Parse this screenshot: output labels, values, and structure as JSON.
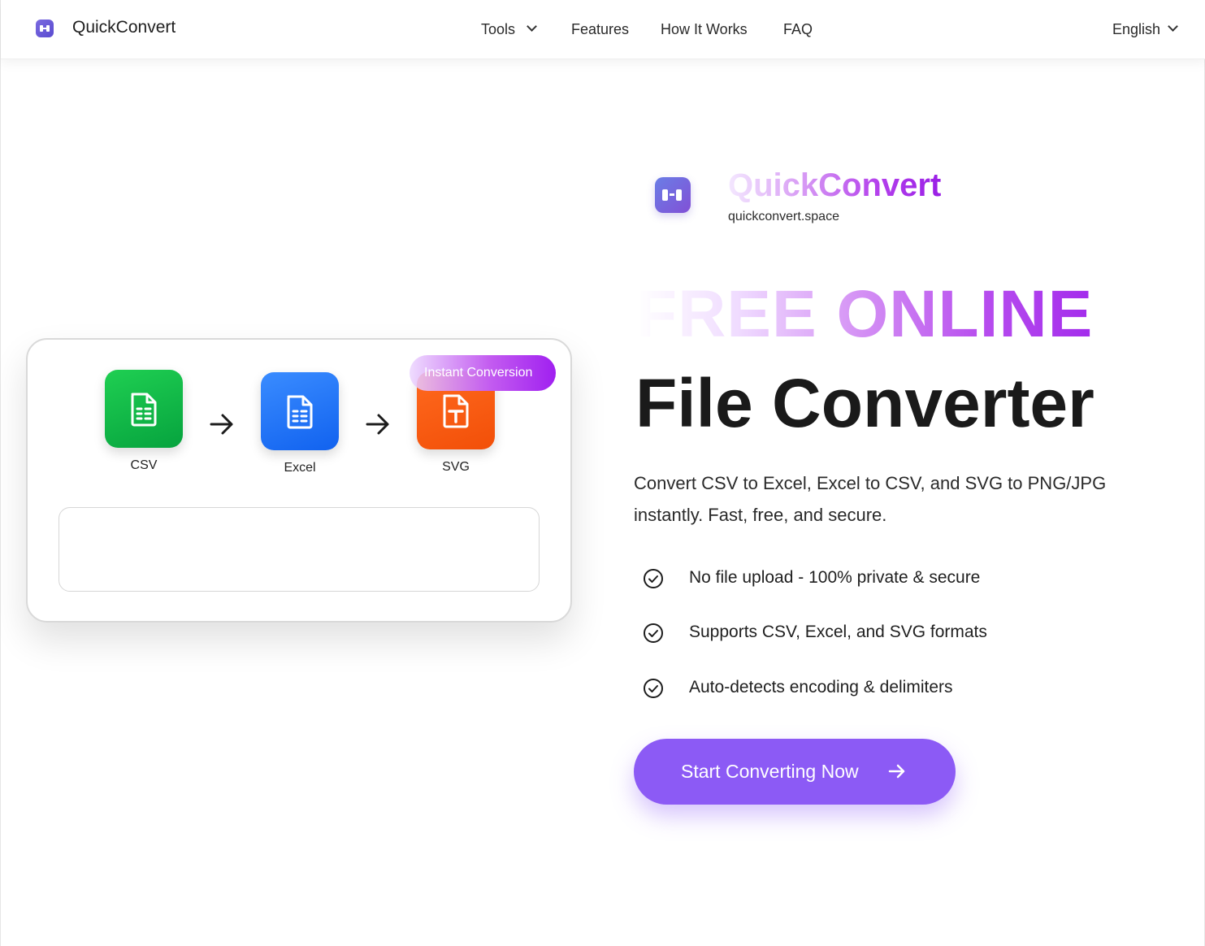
{
  "header": {
    "brand": "QuickConvert",
    "nav": {
      "tools": "Tools",
      "features": "Features",
      "how_it_works": "How It Works",
      "faq": "FAQ"
    },
    "language": "English"
  },
  "converter_card": {
    "badge": "Instant Conversion",
    "formats": {
      "csv": "CSV",
      "excel": "Excel",
      "svg": "SVG"
    }
  },
  "hero": {
    "brand": "QuickConvert",
    "domain": "quickconvert.space",
    "title_line1": "FREE ONLINE",
    "title_line2": "File Converter",
    "description": "Convert CSV to Excel, Excel to CSV, and SVG to PNG/JPG instantly. Fast, free, and secure.",
    "features": [
      "No file upload - 100% private & secure",
      "Supports CSV, Excel, and SVG formats",
      "Auto-detects encoding & delimiters"
    ],
    "cta": "Start Converting Now"
  },
  "colors": {
    "accent": "#8c5af5",
    "csv_tile": "#0aae42",
    "excel_tile": "#1f6ff5",
    "svg_tile": "#f5560c"
  },
  "icons": {
    "logo": "quickconvert-logo-icon",
    "tools_dropdown": "chevron-down-icon",
    "language_dropdown": "chevron-down-icon",
    "feature_bullet": "check-circle-icon",
    "cta_arrow": "arrow-right-icon"
  }
}
